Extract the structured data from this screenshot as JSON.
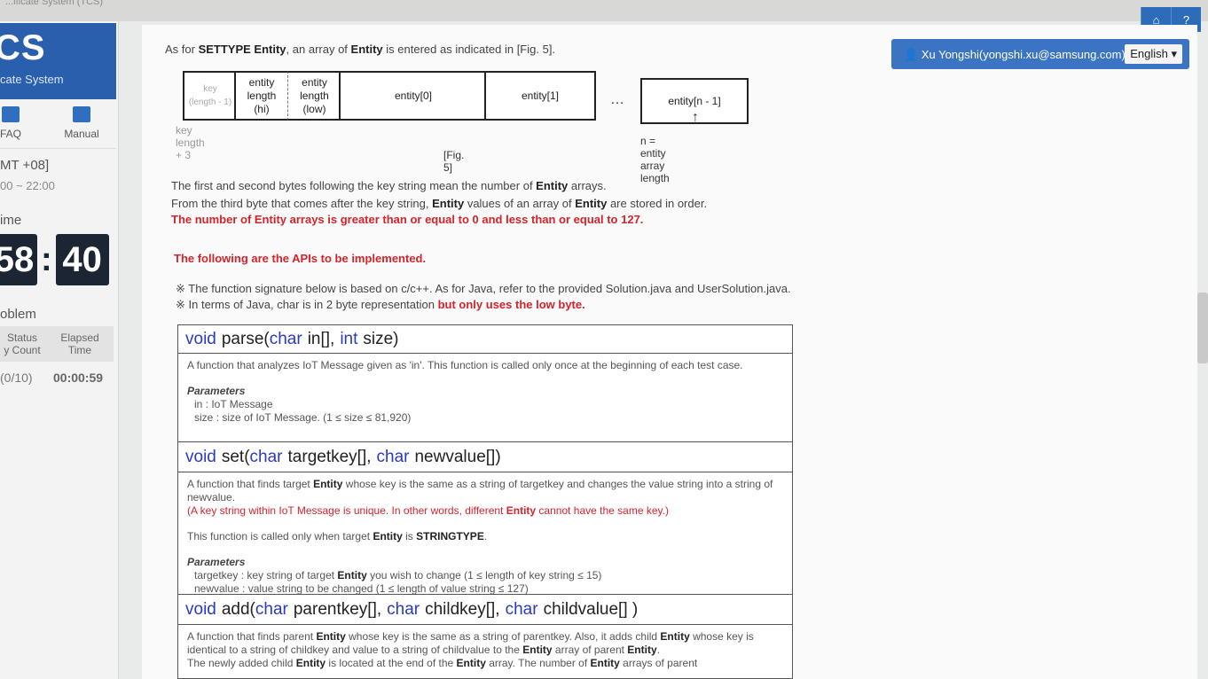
{
  "window": {
    "caption": "...ificate System (TCS)"
  },
  "topbar": {
    "home_icon": "⌂",
    "help_icon": "?"
  },
  "sidebar": {
    "logo": "CS",
    "subtitle": "cate System",
    "quick_links": [
      {
        "label": "FAQ"
      },
      {
        "label": "Manual"
      }
    ],
    "timezone": "MT +08]",
    "time_range": "00 ~ 22:00",
    "time_label": "ime",
    "timer": {
      "minutes": "58",
      "seconds": "40"
    },
    "problem_label": "oblem",
    "status_header": "Status\ny Count",
    "elapsed_header": "Elapsed\nTime",
    "status_value": "(0/10)",
    "elapsed_value": "00:00:59"
  },
  "user": {
    "name": "Xu Yongshi(yongshi.xu@samsung.com)",
    "language": "English"
  },
  "intro": {
    "prefix": "As for ",
    "bold1": "SETTYPE Entity",
    "mid": ", an array of ",
    "bold2": "Entity",
    "suffix": " is entered as indicated in [Fig. 5]."
  },
  "figure": {
    "key_cell": "key\n(length - 1)",
    "len_hi": "entity\nlength\n(hi)",
    "len_low": "entity\nlength\n(low)",
    "entity0": "entity[0]",
    "entity1": "entity[1]",
    "ellipsis": "…",
    "entityn": "entity[n - 1]",
    "arrow": "↑",
    "key_note": "key length + 3",
    "n_note": "n = entity array length",
    "caption": "[Fig. 5]"
  },
  "desc": {
    "line1_a": "The first and second bytes following the key string mean the number of ",
    "line1_b": "Entity",
    "line1_c": " arrays.",
    "line2_a": "From the third byte that comes after the key string, ",
    "line2_b": "Entity",
    "line2_c": " values of an array of ",
    "line2_d": "Entity",
    "line2_e": " are stored in order.",
    "line3": "The number of Entity arrays is greater than or equal to 0 and less than or equal to 127.",
    "apis_heading": "The following are the APIs to be implemented.",
    "note1": "※ The function signature below is based on c/c++. As for Java, refer to the provided Solution.java and UserSolution.java.",
    "note2_a": "※ In terms of Java, char is in 2 byte representation ",
    "note2_b": "but only uses the low byte."
  },
  "api": {
    "parse": {
      "kw1": "void",
      "name": "parse(",
      "kw2": "char",
      "p1": "in[], ",
      "kw3": "int",
      "p2": "size)",
      "desc": "A function that analyzes IoT Message given as 'in'. This function is called only once at the beginning of each test case.",
      "params_title": "Parameters",
      "param1": "in : IoT Message",
      "param2": "size : size of IoT Message. (1 ≤ size ≤ 81,920)"
    },
    "set": {
      "kw1": "void",
      "name": "set(",
      "kw2": "char",
      "p1": "targetkey[], ",
      "kw3": "char",
      "p2": "newvalue[])",
      "desc_a": "A function that finds target ",
      "desc_b": "Entity",
      "desc_c": " whose key is the same as a string of targetkey and changes the value string into a string of newvalue.",
      "red_a": "(A key string within IoT Message is unique. In other words, different ",
      "red_b": "Entity",
      "red_c": " cannot have the same key.)",
      "called_a": "This function is called only when target ",
      "called_b": "Entity",
      "called_c": " is ",
      "called_d": "STRINGTYPE",
      "called_e": ".",
      "params_title": "Parameters",
      "param1_a": "targetkey : key string of target ",
      "param1_b": "Entity",
      "param1_c": " you wish to change (1 ≤ length of key string ≤ 15)",
      "param2": "newvalue : value string to be changed (1 ≤ length of value string ≤ 127)"
    },
    "add": {
      "kw1": "void",
      "name": "add(",
      "kw2": "char",
      "p1": "parentkey[], ",
      "kw3": "char",
      "p2": "childkey[], ",
      "kw4": "char",
      "p3": "childvalue[] )",
      "desc_a": "A function that finds parent ",
      "desc_b": "Entity",
      "desc_c": " whose key is the same as a string of parentkey. Also, it adds child ",
      "desc_d": "Entity",
      "desc_e": " whose key is identical to a string of childkey and value to a string of childvalue to the ",
      "desc_f": "Entity",
      "desc_g": " array of parent ",
      "desc_h": "Entity",
      "desc_i": ".",
      "cut_a": "The newly added child ",
      "cut_b": "Entity",
      "cut_c": " is located at the end of the ",
      "cut_d": "Entity",
      "cut_e": " array. The number of ",
      "cut_f": "Entity",
      "cut_g": " arrays of parent"
    }
  }
}
